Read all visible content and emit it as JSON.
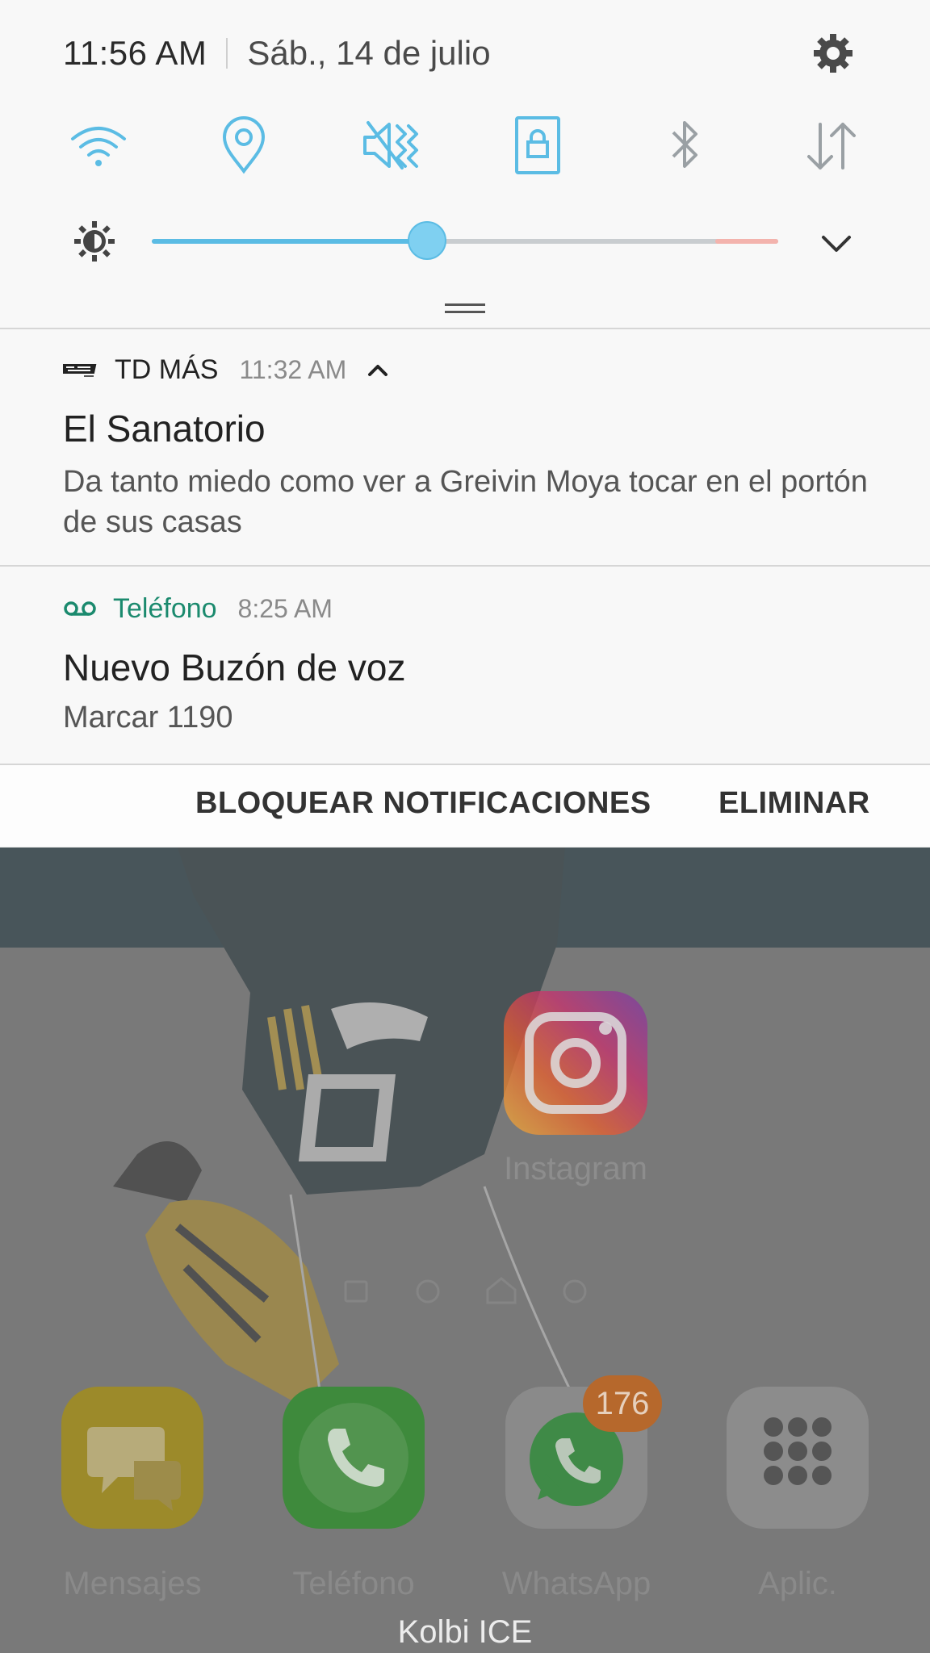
{
  "status_bar": {
    "time": "11:56 AM",
    "date": "Sáb., 14 de julio",
    "settings_icon": "gear-icon"
  },
  "quick_settings": {
    "accent_color": "#5bbce4",
    "inactive_color": "#9aa0a4",
    "tiles": [
      {
        "icon": "wifi-icon",
        "active": true
      },
      {
        "icon": "location-icon",
        "active": true
      },
      {
        "icon": "vibrate-mute-icon",
        "active": true
      },
      {
        "icon": "screen-lock-rotation-icon",
        "active": true
      },
      {
        "icon": "bluetooth-icon",
        "active": false
      },
      {
        "icon": "mobile-data-icon",
        "active": false
      }
    ]
  },
  "brightness": {
    "level": 0.44,
    "icon": "brightness-icon"
  },
  "notifications": [
    {
      "app": "TD MÁS",
      "time": "11:32 AM",
      "title": "El Sanatorio",
      "body": "Da tanto miedo como ver a Greivin Moya tocar en el portón de sus casas"
    },
    {
      "app": "Teléfono",
      "time": "8:25 AM",
      "title": "Nuevo Buzón de voz",
      "body": "Marcar 1190",
      "accent_color": "#1b8a6e"
    }
  ],
  "actions": {
    "block": "BLOQUEAR NOTIFICACIONES",
    "clear": "ELIMINAR"
  },
  "home_screen": {
    "app_instagram": "Instagram",
    "dock": [
      "Mensajes",
      "Teléfono",
      "WhatsApp",
      "Aplic."
    ],
    "whatsapp_badge": "176",
    "carrier": "Kolbi ICE"
  }
}
